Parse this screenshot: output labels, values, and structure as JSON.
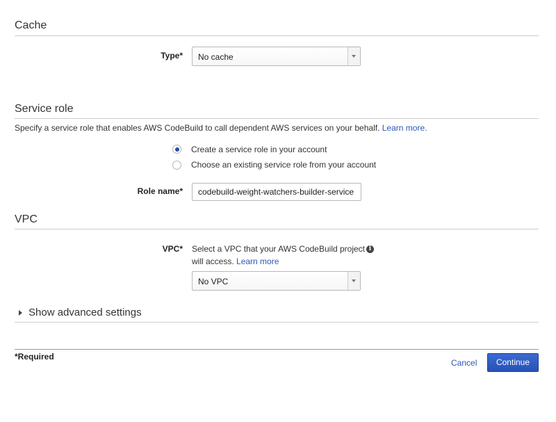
{
  "cache": {
    "title": "Cache",
    "type_label": "Type*",
    "type_value": "No cache"
  },
  "service_role": {
    "title": "Service role",
    "description": "Specify a service role that enables AWS CodeBuild to call dependent AWS services on your behalf.",
    "learn_more": "Learn more.",
    "options": [
      {
        "label": "Create a service role in your account",
        "selected": true
      },
      {
        "label": "Choose an existing service role from your account",
        "selected": false
      }
    ],
    "role_name_label": "Role name*",
    "role_name_value": "codebuild-weight-watchers-builder-service"
  },
  "vpc": {
    "title": "VPC",
    "label": "VPC*",
    "help_line1": "Select a VPC that your AWS CodeBuild project",
    "help_line2": "will access.",
    "learn_more": "Learn more",
    "select_value": "No VPC",
    "info_icon": "info-circle-icon"
  },
  "advanced": {
    "label": "Show advanced settings",
    "icon": "caret-right-icon"
  },
  "footer": {
    "required_note": "*Required",
    "cancel_label": "Cancel",
    "continue_label": "Continue"
  },
  "colors": {
    "accent": "#2a57b5",
    "primary_button": "#3163c7",
    "radio_selected": "#2a4aa6"
  }
}
